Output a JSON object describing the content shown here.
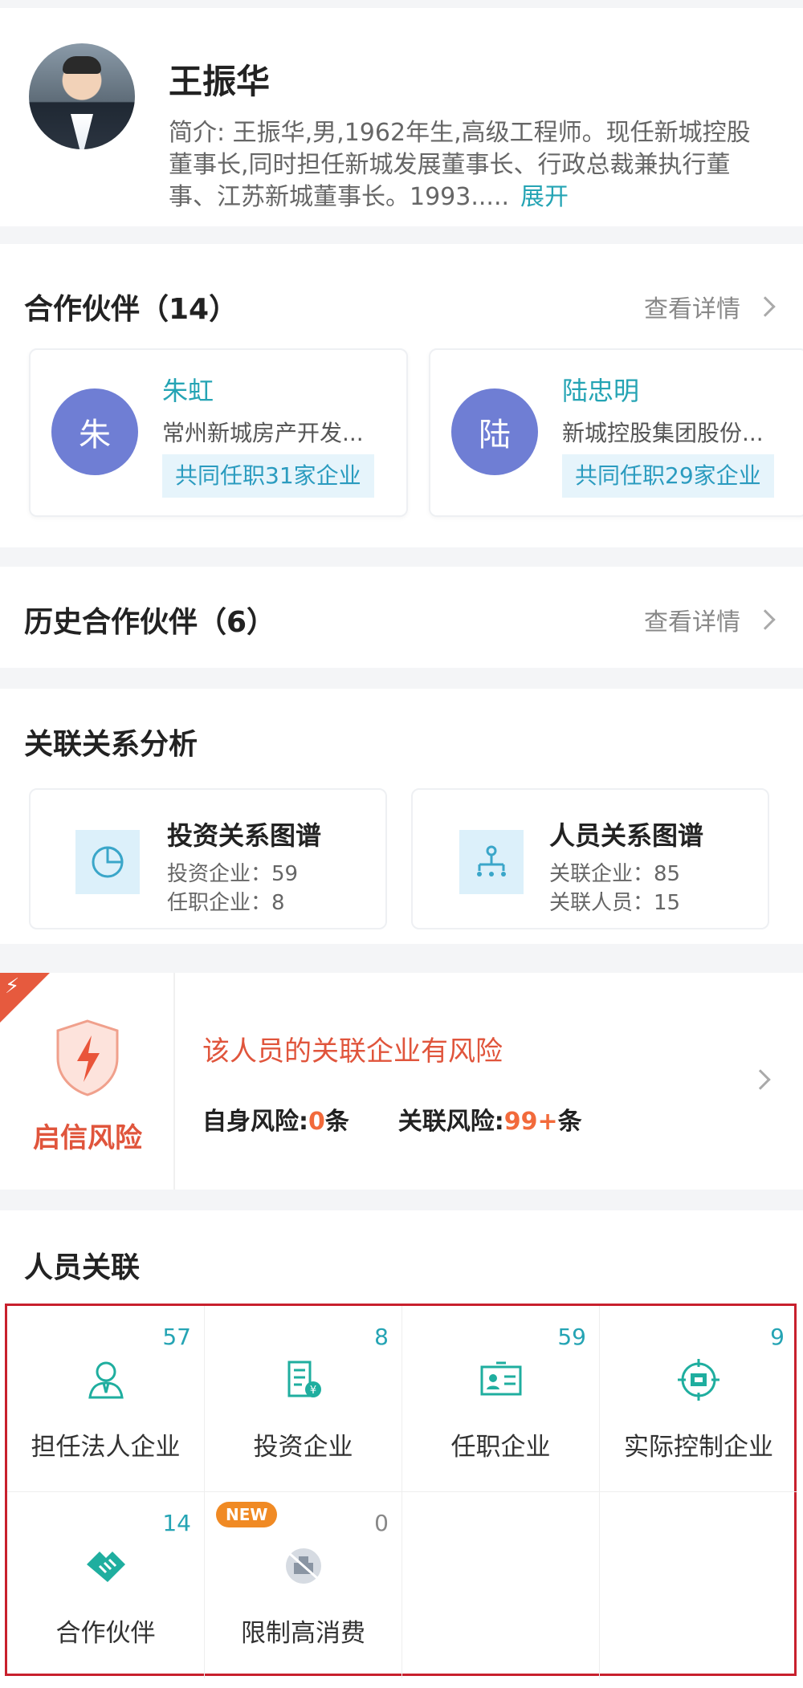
{
  "profile": {
    "name": "王振华",
    "intro": "简介: 王振华,男,1962年生,高级工程师。现任新城控股董事长,同时担任新城发展董事长、行政总裁兼执行董事、江苏新城董事长。1993.....",
    "expand_label": "展开"
  },
  "partners": {
    "title": "合作伙伴（14）",
    "see_more": "查看详情",
    "items": [
      {
        "initial": "朱",
        "name": "朱虹",
        "company": "常州新城房产开发...",
        "tag": "共同任职31家企业"
      },
      {
        "initial": "陆",
        "name": "陆忠明",
        "company": "新城控股集团股份...",
        "tag": "共同任职29家企业"
      }
    ]
  },
  "history": {
    "title": "历史合作伙伴（6）",
    "see_more": "查看详情"
  },
  "analysis": {
    "title": "关联关系分析",
    "cards": [
      {
        "title": "投资关系图谱",
        "line1": "投资企业：59",
        "line2": "任职企业：8",
        "icon": "pie-chart-icon"
      },
      {
        "title": "人员关系图谱",
        "line1": "关联企业：85",
        "line2": "关联人员：15",
        "icon": "org-chart-icon"
      }
    ]
  },
  "risk": {
    "label": "启信风险",
    "headline": "该人员的关联企业有风险",
    "self_label": "自身风险:",
    "self_count": "0",
    "self_unit": "条",
    "related_label": "关联风险:",
    "related_count": "99+",
    "related_unit": "条"
  },
  "relations": {
    "title": "人员关联",
    "new_badge": "NEW",
    "items": [
      {
        "label": "担任法人企业",
        "count": "57",
        "icon": "person-icon"
      },
      {
        "label": "投资企业",
        "count": "8",
        "icon": "invest-building-icon"
      },
      {
        "label": "任职企业",
        "count": "59",
        "icon": "id-card-icon"
      },
      {
        "label": "实际控制企业",
        "count": "9",
        "icon": "target-icon"
      },
      {
        "label": "合作伙伴",
        "count": "14",
        "icon": "handshake-icon"
      },
      {
        "label": "限制高消费",
        "count": "0",
        "icon": "restricted-consumption-icon"
      }
    ]
  },
  "colors": {
    "accent": "#25a4b4",
    "risk": "#e0553c",
    "avatar_bg": "#6f7ed4",
    "highlight_border": "#c8202d"
  }
}
